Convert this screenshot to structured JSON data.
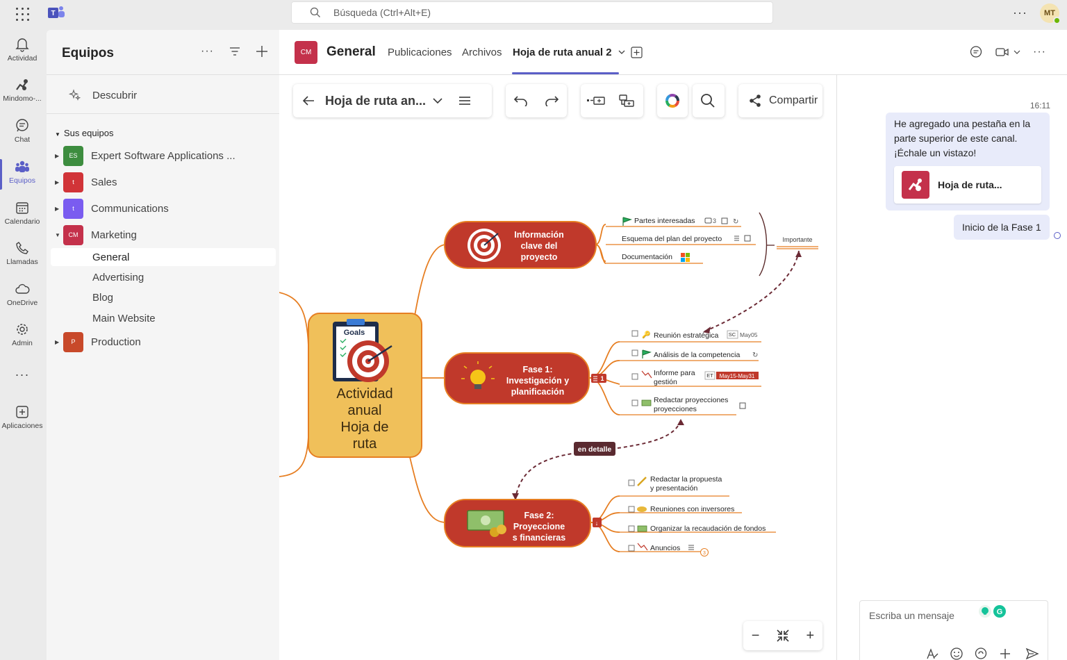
{
  "topbar": {
    "search_placeholder": "Búsqueda (Ctrl+Alt+E)",
    "more": "···",
    "avatar_initials": "MT"
  },
  "rail": {
    "items": [
      {
        "label": "Actividad",
        "icon": "bell-icon"
      },
      {
        "label": "Mindomo-...",
        "icon": "mindomo-icon"
      },
      {
        "label": "Chat",
        "icon": "chat-icon"
      },
      {
        "label": "Equipos",
        "icon": "teams-icon",
        "active": true
      },
      {
        "label": "Calendario",
        "icon": "calendar-icon"
      },
      {
        "label": "Llamadas",
        "icon": "phone-icon"
      },
      {
        "label": "OneDrive",
        "icon": "cloud-icon"
      },
      {
        "label": "Admin",
        "icon": "admin-icon"
      },
      {
        "label": "Aplicaciones",
        "icon": "apps-icon"
      }
    ],
    "more": "···"
  },
  "panel": {
    "title": "Equipos",
    "discover": "Descubrir",
    "your_teams": "Sus equipos",
    "teams": [
      {
        "initials": "ES",
        "name": "Expert Software Applications ...",
        "color": "#3d8d3f"
      },
      {
        "initials": "t",
        "name": "Sales",
        "color": "#d13438"
      },
      {
        "initials": "t",
        "name": "Communications",
        "color": "#7a5cf0"
      },
      {
        "initials": "CM",
        "name": "Marketing",
        "color": "#c4314b"
      },
      {
        "initials": "P",
        "name": "Production",
        "color": "#c8492a"
      }
    ],
    "channels": [
      "General",
      "Advertising",
      "Blog",
      "Main Website"
    ]
  },
  "header": {
    "team_initials": "CM",
    "channel": "General",
    "tabs": [
      "Publicaciones",
      "Archivos",
      "Hoja de ruta anual 2"
    ]
  },
  "toolbar": {
    "title": "Hoja de ruta an...",
    "share": "Compartir"
  },
  "mindmap": {
    "central": [
      "Actividad",
      "anual",
      "Hoja de",
      "ruta"
    ],
    "goals": "Goals",
    "nodes": [
      {
        "title": [
          "Información",
          "clave del",
          "proyecto"
        ]
      },
      {
        "title": [
          "Fase 1:",
          "Investigación y",
          "planificación"
        ]
      },
      {
        "title": [
          "Fase 2:",
          "Proyeccione",
          "s financieras"
        ]
      }
    ],
    "info_items": [
      "Partes interesadas",
      "Esquema del plan del proyecto",
      "Documentación"
    ],
    "info_count": "3",
    "important": "Importante",
    "fase1_items": [
      "Reunión estratégica",
      "Análisis de la competencia",
      "Informe para",
      "gestión",
      "Redactar proyecciones",
      "proyecciones"
    ],
    "fase1_badge": "1",
    "meeting_tag": "SC",
    "meeting_date": "May05",
    "report_tag": "ET",
    "report_dates": "May15-May31",
    "detail_label": "en detalle",
    "fase2_items": [
      "Redactar la propuesta",
      "y presentación",
      "Reuniones con inversores",
      "Organizar la recaudación de fondos",
      "Anuncios"
    ],
    "fase2_count": "3",
    "colors": {
      "node": "#c0392b",
      "branch": "#e67e22",
      "central": "#f0c05a",
      "dash": "#6b2a35"
    }
  },
  "chat": {
    "time": "16:11",
    "message": "He agregado una pestaña en la parte superior de este canal. ¡Échale un vistazo!",
    "card_title": "Hoja de ruta...",
    "reply": "Inicio de la Fase 1",
    "compose_placeholder": "Escriba un mensaje"
  },
  "zoom": {
    "minus": "−",
    "plus": "+"
  }
}
